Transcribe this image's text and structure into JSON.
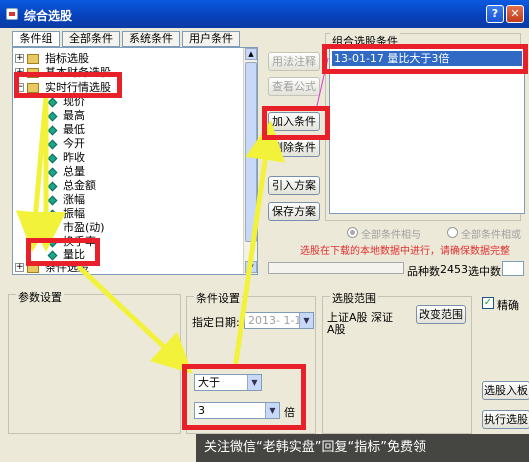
{
  "window": {
    "title": "综合选股"
  },
  "tabs": [
    "条件组",
    "全部条件",
    "系统条件",
    "用户条件"
  ],
  "tree": {
    "folders": [
      "指标选股",
      "基本财务选股",
      "实时行情选股",
      "条件选股"
    ],
    "items": [
      "现价",
      "最高",
      "最低",
      "今开",
      "昨收",
      "总量",
      "总金额",
      "涨幅",
      "振幅",
      "市盈(动)",
      "换手率",
      "量比"
    ]
  },
  "buttons": {
    "usage": "用法注释",
    "view_formula": "查看公式",
    "add_condition": "加入条件",
    "delete_condition": "删除条件",
    "import_plan": "引入方案",
    "save_plan": "保存方案",
    "change_range": "改变范围",
    "select_into": "选股入板",
    "execute": "执行选股"
  },
  "condition_group": {
    "label": "组合选股条件",
    "items": [
      "13-01-17 量比大于3倍"
    ]
  },
  "radios": {
    "all_and": "全部条件相与",
    "all_or": "全部条件相或"
  },
  "note": "选股在下载的本地数据中进行，请确保数据完整",
  "stats": {
    "count_label": "品种数",
    "count_value": "2453",
    "selected_label": "选中数"
  },
  "params": {
    "label": "参数设置"
  },
  "cond_settings": {
    "label": "条件设置",
    "date_label": "指定日期:",
    "date_value": "2013- 1-17",
    "operator": "大于",
    "value": "3",
    "unit": "倍"
  },
  "range": {
    "label": "选股范围",
    "text1": "上证A股 深证",
    "text2": "A股"
  },
  "options": {
    "precise_label": "精确"
  },
  "watermark": "关注微信“老韩实盘”回复“指标”免费领",
  "colors": {
    "highlight": "#e8202a",
    "arrow": "#f2f23a",
    "accent": "#316ac5"
  }
}
